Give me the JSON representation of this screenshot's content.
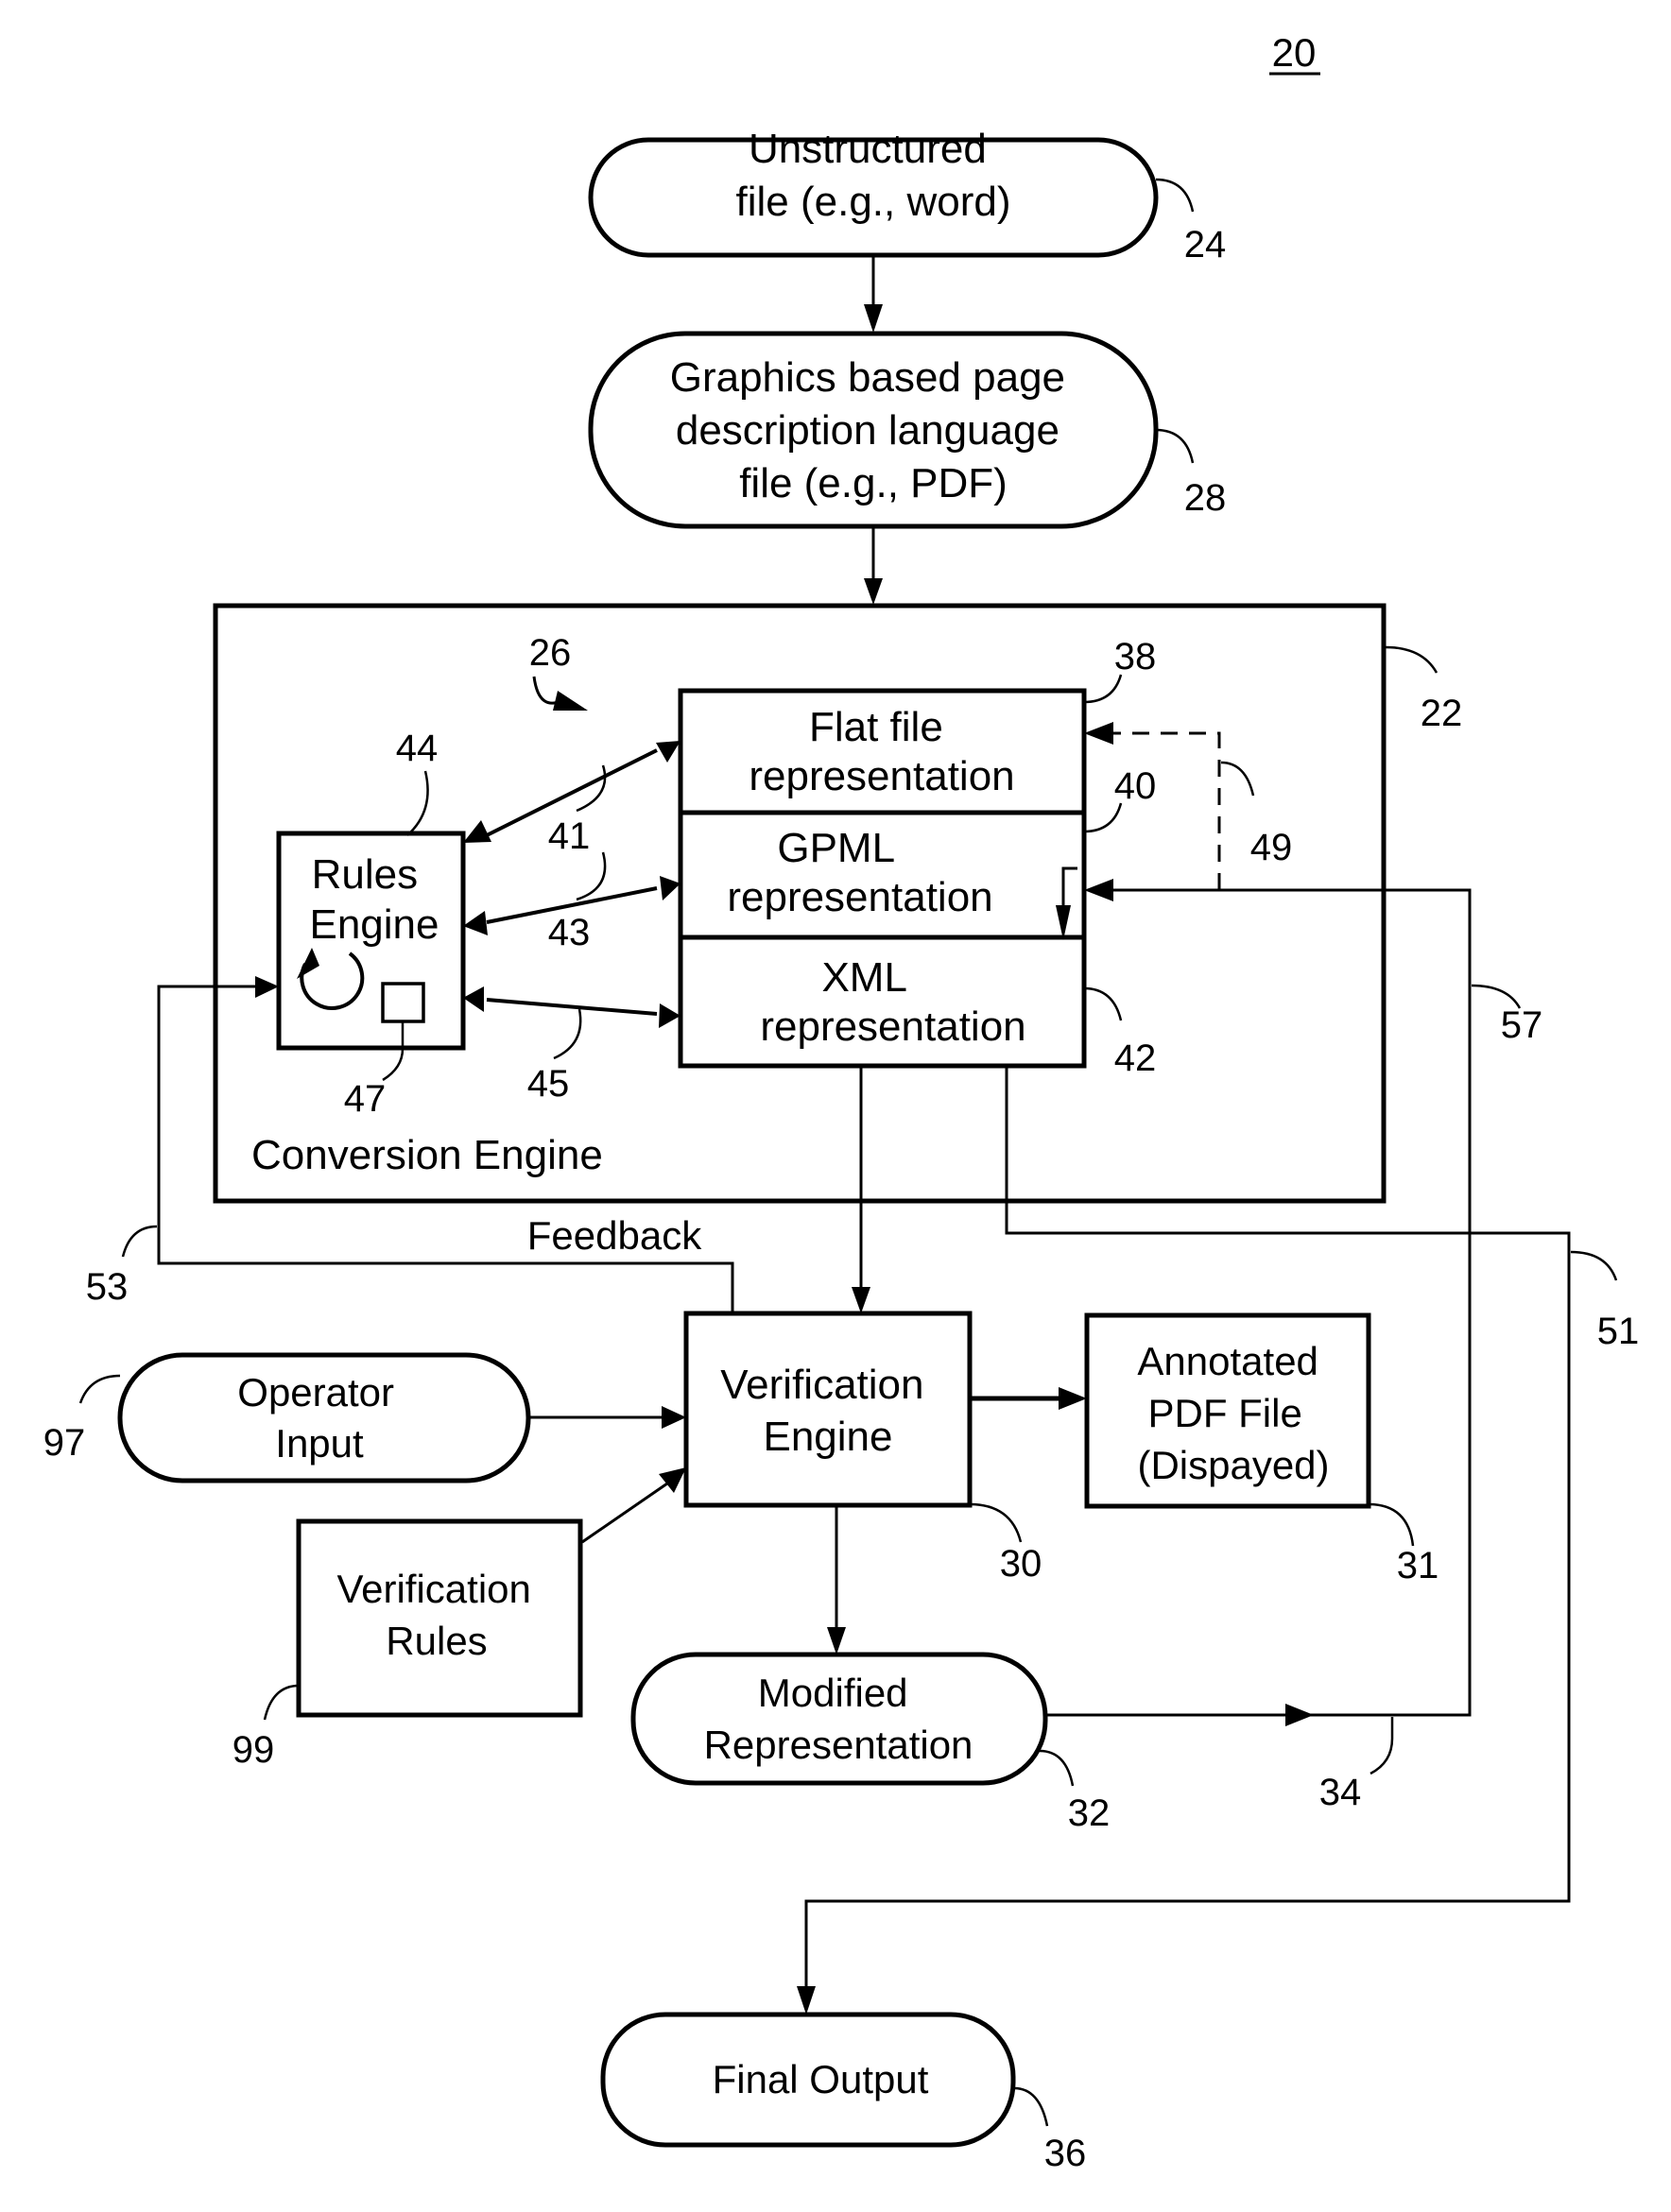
{
  "figure": {
    "number": "20"
  },
  "nodes": {
    "unstructured_file": {
      "lines": [
        "Unstructured",
        "file (e.g., word)"
      ],
      "ref": "24"
    },
    "pdl_file": {
      "lines": [
        "Graphics based page",
        "description language",
        "file (e.g., PDF)"
      ],
      "ref": "28"
    },
    "conversion_engine": {
      "label": "Conversion Engine",
      "ref": "22",
      "group_ref": "26"
    },
    "flat_file": {
      "lines": [
        "Flat file",
        "representation"
      ],
      "ref": "38"
    },
    "gpml": {
      "lines": [
        "GPML",
        "representation"
      ],
      "ref": "40"
    },
    "xml": {
      "lines": [
        "XML",
        "representation"
      ],
      "ref": "42"
    },
    "rules_engine": {
      "lines": [
        "Rules",
        "Engine"
      ],
      "ref": "44",
      "component_ref": "47"
    },
    "verification_engine": {
      "lines": [
        "Verification",
        "Engine"
      ],
      "ref": "30"
    },
    "annotated_pdf": {
      "lines": [
        "Annotated",
        "PDF File",
        "(Dispayed)"
      ],
      "ref": "31"
    },
    "operator_input": {
      "lines": [
        "Operator",
        "Input"
      ],
      "ref": "97"
    },
    "verification_rules": {
      "lines": [
        "Verification",
        "Rules"
      ],
      "ref": "99"
    },
    "modified_representation": {
      "lines": [
        "Modified",
        "Representation"
      ],
      "ref": "32"
    },
    "final_output": {
      "lines": [
        "Final Output"
      ],
      "ref": "36"
    }
  },
  "connectors": {
    "arrow_41": "41",
    "arrow_43": "43",
    "arrow_45": "45",
    "dashed_49": "49",
    "path_51": "51",
    "feedback_53": "53",
    "path_57": "57",
    "path_34": "34",
    "feedback_label": "Feedback"
  }
}
